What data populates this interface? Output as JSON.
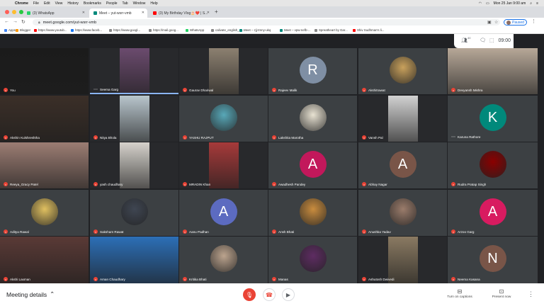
{
  "menubar": {
    "items": [
      "Chrome",
      "File",
      "Edit",
      "View",
      "History",
      "Bookmarks",
      "People",
      "Tab",
      "Window",
      "Help"
    ],
    "clock": "Mon 25 Jan  9:00 am"
  },
  "tabs": [
    {
      "label": "(3) WhatsApp",
      "color": "#25d366"
    },
    {
      "label": "Meet – yut-wsrr-vmb",
      "color": "#00897b"
    },
    {
      "label": "(3) My Birthday Vlog🎂❤️ | S...",
      "color": "#ff0000"
    }
  ],
  "address": {
    "url": "meet.google.com/yut-wsrr-vmb",
    "profile_status": "Paused"
  },
  "bookmarks": [
    {
      "label": "Apps",
      "color": "#4285f4"
    },
    {
      "label": "Blogger",
      "color": "#ff9800"
    },
    {
      "label": "https://www.youtub...",
      "color": "#ff0000"
    },
    {
      "label": "https://www.faceb...",
      "color": "#1877f2"
    },
    {
      "label": "https://www.googl...",
      "color": "#888"
    },
    {
      "label": "https://mail.goog...",
      "color": "#888"
    },
    {
      "label": "WhatsApp",
      "color": "#25d366"
    },
    {
      "label": "calivate_english_4...",
      "color": "#888"
    },
    {
      "label": "Meet – zjj-tmny-ukq",
      "color": "#00897b"
    },
    {
      "label": "Meet – vpw-nefb-...",
      "color": "#00897b"
    },
    {
      "label": "Spreatheart by Gar...",
      "color": "#888"
    },
    {
      "label": "Shiv Sudhman's li...",
      "color": "#ff0000"
    }
  ],
  "info_panel": {
    "participants_badge": "40",
    "time": "09:00"
  },
  "participants": [
    {
      "name": "You",
      "kind": "video",
      "bg": "#1b1b1b"
    },
    {
      "name": "Seema Garg",
      "kind": "video",
      "bg": "#6b4b6e",
      "speaking": true
    },
    {
      "name": "Gaurav Dhariwal",
      "kind": "video",
      "bg": "#8c8070"
    },
    {
      "name": "Rajeev Malik",
      "kind": "letter",
      "letter": "R",
      "color": "#7f8fa4"
    },
    {
      "name": "Akshitrawat",
      "kind": "photo",
      "bg": "#c9a15c"
    },
    {
      "name": "Devyansh Mishra",
      "kind": "video",
      "bg": "#b7a898"
    },
    {
      "name": "Akshin Kulshreshtha",
      "kind": "video",
      "bg": "#3b2f28"
    },
    {
      "name": "Nitya Bhola",
      "kind": "video",
      "bg": "#b9c6cd"
    },
    {
      "name": "YASHU RAJPUT",
      "kind": "photo",
      "bg": "#58a8b8"
    },
    {
      "name": "Lakshita Marotha",
      "kind": "photo",
      "bg": "#e8e2d2"
    },
    {
      "name": "Vansh Pal",
      "kind": "video",
      "bg": "#d2d2d2"
    },
    {
      "name": "Karuna Rathore",
      "kind": "letter",
      "letter": "K",
      "color": "#00897b",
      "dots": true
    },
    {
      "name": "Reeya_Gracy Patel",
      "kind": "video",
      "bg": "#9c7d73"
    },
    {
      "name": "yash chaudhary",
      "kind": "video",
      "bg": "#d6d2cc"
    },
    {
      "name": "MRADIN Khan",
      "kind": "video",
      "bg": "#a63a3a"
    },
    {
      "name": "Awadhesh Pandey",
      "kind": "letter",
      "letter": "A",
      "color": "#c2185b"
    },
    {
      "name": "Abhay Nagar",
      "kind": "letter",
      "letter": "A",
      "color": "#795548"
    },
    {
      "name": "Rudra Pratap Singh",
      "kind": "photo",
      "bg": "#8b0000"
    },
    {
      "name": "Aditya Rawal",
      "kind": "photo",
      "bg": "#e0c060"
    },
    {
      "name": "Saksham Rawat",
      "kind": "photo",
      "bg": "#3f4652"
    },
    {
      "name": "Aanu Padhan",
      "kind": "letter",
      "letter": "A",
      "color": "#5c6bc0"
    },
    {
      "name": "Ansh Bhati",
      "kind": "photo",
      "bg": "#c98c3e"
    },
    {
      "name": "Anushka Yadav",
      "kind": "photo",
      "bg": "#9b7c6b"
    },
    {
      "name": "Arzoo Garg",
      "kind": "letter",
      "letter": "A",
      "color": "#d81b60"
    },
    {
      "name": "Akshi Laxman",
      "kind": "video",
      "bg": "#5a3a36"
    },
    {
      "name": "Aman Chaudhary",
      "kind": "video",
      "bg": "#2c6fb7"
    },
    {
      "name": "Kritika Bhati",
      "kind": "photo",
      "bg": "#bca48e"
    },
    {
      "name": "Manas",
      "kind": "photo",
      "bg": "#5e2c62"
    },
    {
      "name": "Ashutosh Dwivedi",
      "kind": "video",
      "bg": "#8a7a62"
    },
    {
      "name": "Neema Kasana",
      "kind": "letter",
      "letter": "N",
      "color": "#795548"
    }
  ],
  "bottom": {
    "meeting_details": "Meeting details",
    "captions_label": "Turn on captions",
    "present_label": "Present now"
  }
}
